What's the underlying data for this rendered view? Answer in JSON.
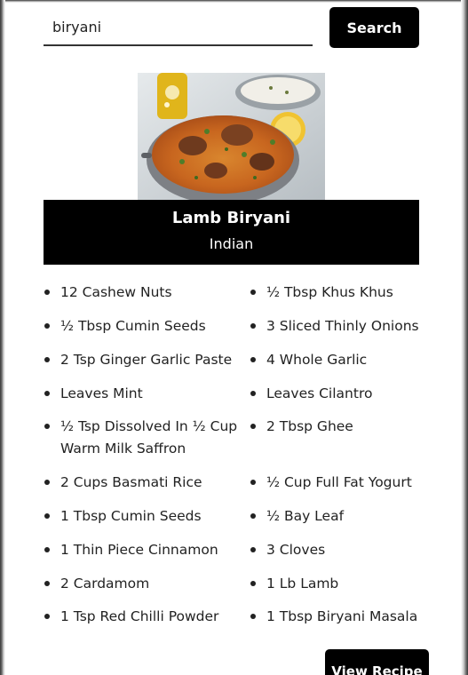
{
  "search": {
    "value": "biryani",
    "button_label": "Search"
  },
  "recipe": {
    "title": "Lamb Biryani",
    "cuisine": "Indian",
    "ingredients_left": [
      "12 Cashew Nuts",
      "½ Tbsp Cumin Seeds",
      "2 Tsp Ginger Garlic Paste",
      "Leaves Mint",
      "½ Tsp Dissolved In ½ Cup Warm Milk Saffron",
      "2 Cups Basmati Rice",
      "1 Tbsp Cumin Seeds",
      "1 Thin Piece Cinnamon",
      "2 Cardamom",
      "1 Tsp Red Chilli Powder"
    ],
    "ingredients_right": [
      "½ Tbsp Khus Khus",
      "3 Sliced Thinly Onions",
      "4 Whole Garlic",
      "Leaves Cilantro",
      "2 Tbsp Ghee",
      "½ Cup Full Fat Yogurt",
      "½ Bay Leaf",
      "3 Cloves",
      "1 Lb Lamb",
      "1 Tbsp Biryani Masala"
    ],
    "view_button_label": "View Recipe"
  },
  "colors": {
    "accent": "#000000",
    "text": "#222222",
    "background": "#ffffff"
  }
}
